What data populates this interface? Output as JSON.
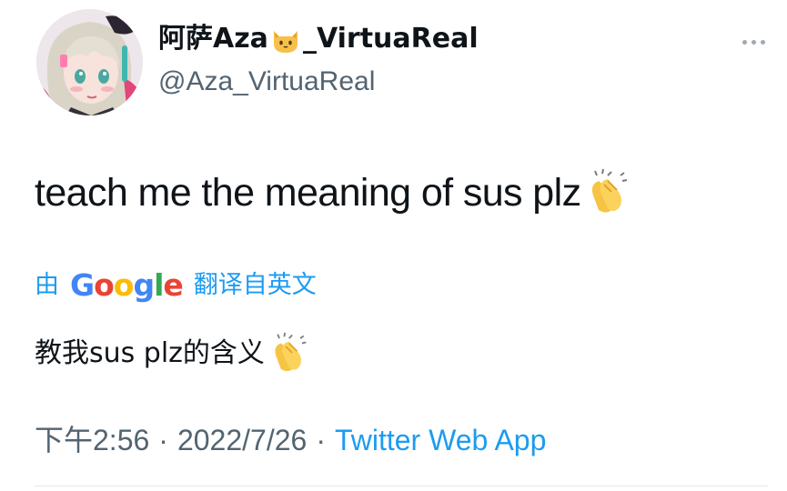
{
  "author": {
    "display_name": "阿萨Aza",
    "display_name_suffix": "_VirtuaReal",
    "name_emoji": "cat-face-icon",
    "handle": "@Aza_VirtuaReal",
    "avatar": "avatar-anime-character"
  },
  "tweet": {
    "text": "teach me the meaning of sus plz",
    "text_emoji": "clapping-hands-icon"
  },
  "translation": {
    "by_label": "由",
    "provider": "Google",
    "provider_letters": [
      "G",
      "o",
      "o",
      "g",
      "l",
      "e"
    ],
    "from_label": "翻译自英文",
    "text": "教我sus plz的含义",
    "text_emoji": "clapping-hands-icon"
  },
  "meta": {
    "time": "下午2:56",
    "separator": "·",
    "date": "2022/7/26",
    "source": "Twitter Web App"
  },
  "colors": {
    "link": "#1d9bf0",
    "secondary_text": "#536471",
    "primary_text": "#0f1419"
  }
}
